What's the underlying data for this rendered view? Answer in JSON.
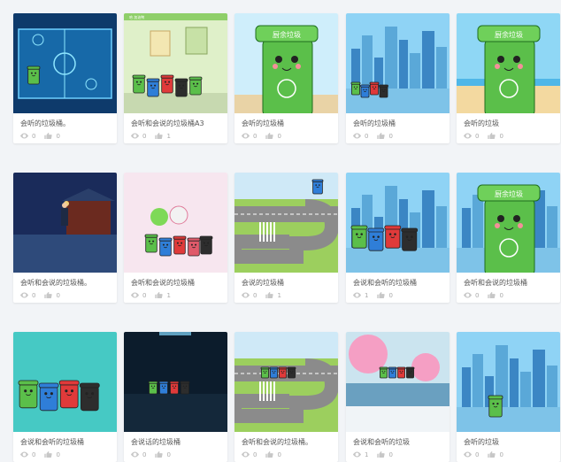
{
  "projects": [
    {
      "title": "会听的垃圾桶。",
      "views": "0",
      "likes": "0",
      "thumb": "hockey"
    },
    {
      "title": "会听和会说的垃圾桶A3",
      "views": "0",
      "likes": "1",
      "thumb": "room"
    },
    {
      "title": "会听的垃圾桶",
      "views": "0",
      "likes": "0",
      "thumb": "bigcan"
    },
    {
      "title": "会听的垃圾桶",
      "views": "0",
      "likes": "0",
      "thumb": "city"
    },
    {
      "title": "会听的垃圾",
      "views": "0",
      "likes": "0",
      "thumb": "beach"
    },
    {
      "title": "会听和会说的垃圾桶。",
      "views": "0",
      "likes": "0",
      "thumb": "night"
    },
    {
      "title": "会听和会说的垃圾桶",
      "views": "0",
      "likes": "1",
      "thumb": "cute"
    },
    {
      "title": "会说的垃圾桶",
      "views": "0",
      "likes": "1",
      "thumb": "road"
    },
    {
      "title": "会说和会听的垃圾桶",
      "views": "1",
      "likes": "0",
      "thumb": "city4"
    },
    {
      "title": "会听和会说的垃圾桶",
      "views": "0",
      "likes": "0",
      "thumb": "bigcan2"
    },
    {
      "title": "会说和会听的垃圾桶",
      "views": "0",
      "likes": "0",
      "thumb": "teal"
    },
    {
      "title": "会说话的垃圾桶",
      "views": "0",
      "likes": "0",
      "thumb": "dark"
    },
    {
      "title": "会听和会说的垃圾桶。",
      "views": "0",
      "likes": "0",
      "thumb": "road2"
    },
    {
      "title": "会说和会听的垃圾",
      "views": "1",
      "likes": "0",
      "thumb": "blossom"
    },
    {
      "title": "会听的垃圾",
      "views": "0",
      "likes": "0",
      "thumb": "city2"
    }
  ],
  "thumb_text": {
    "can_label": "厨余垃圾",
    "room_header": "哈 加油鸭"
  },
  "colors": {
    "can_green": "#5bbf4a",
    "can_blue": "#2f7ed8",
    "can_red": "#e03a3a",
    "can_black": "#2d2d2d",
    "sky": "#7cc7f0"
  },
  "icons": {
    "view": "eye-icon",
    "like": "thumb-up-icon"
  }
}
